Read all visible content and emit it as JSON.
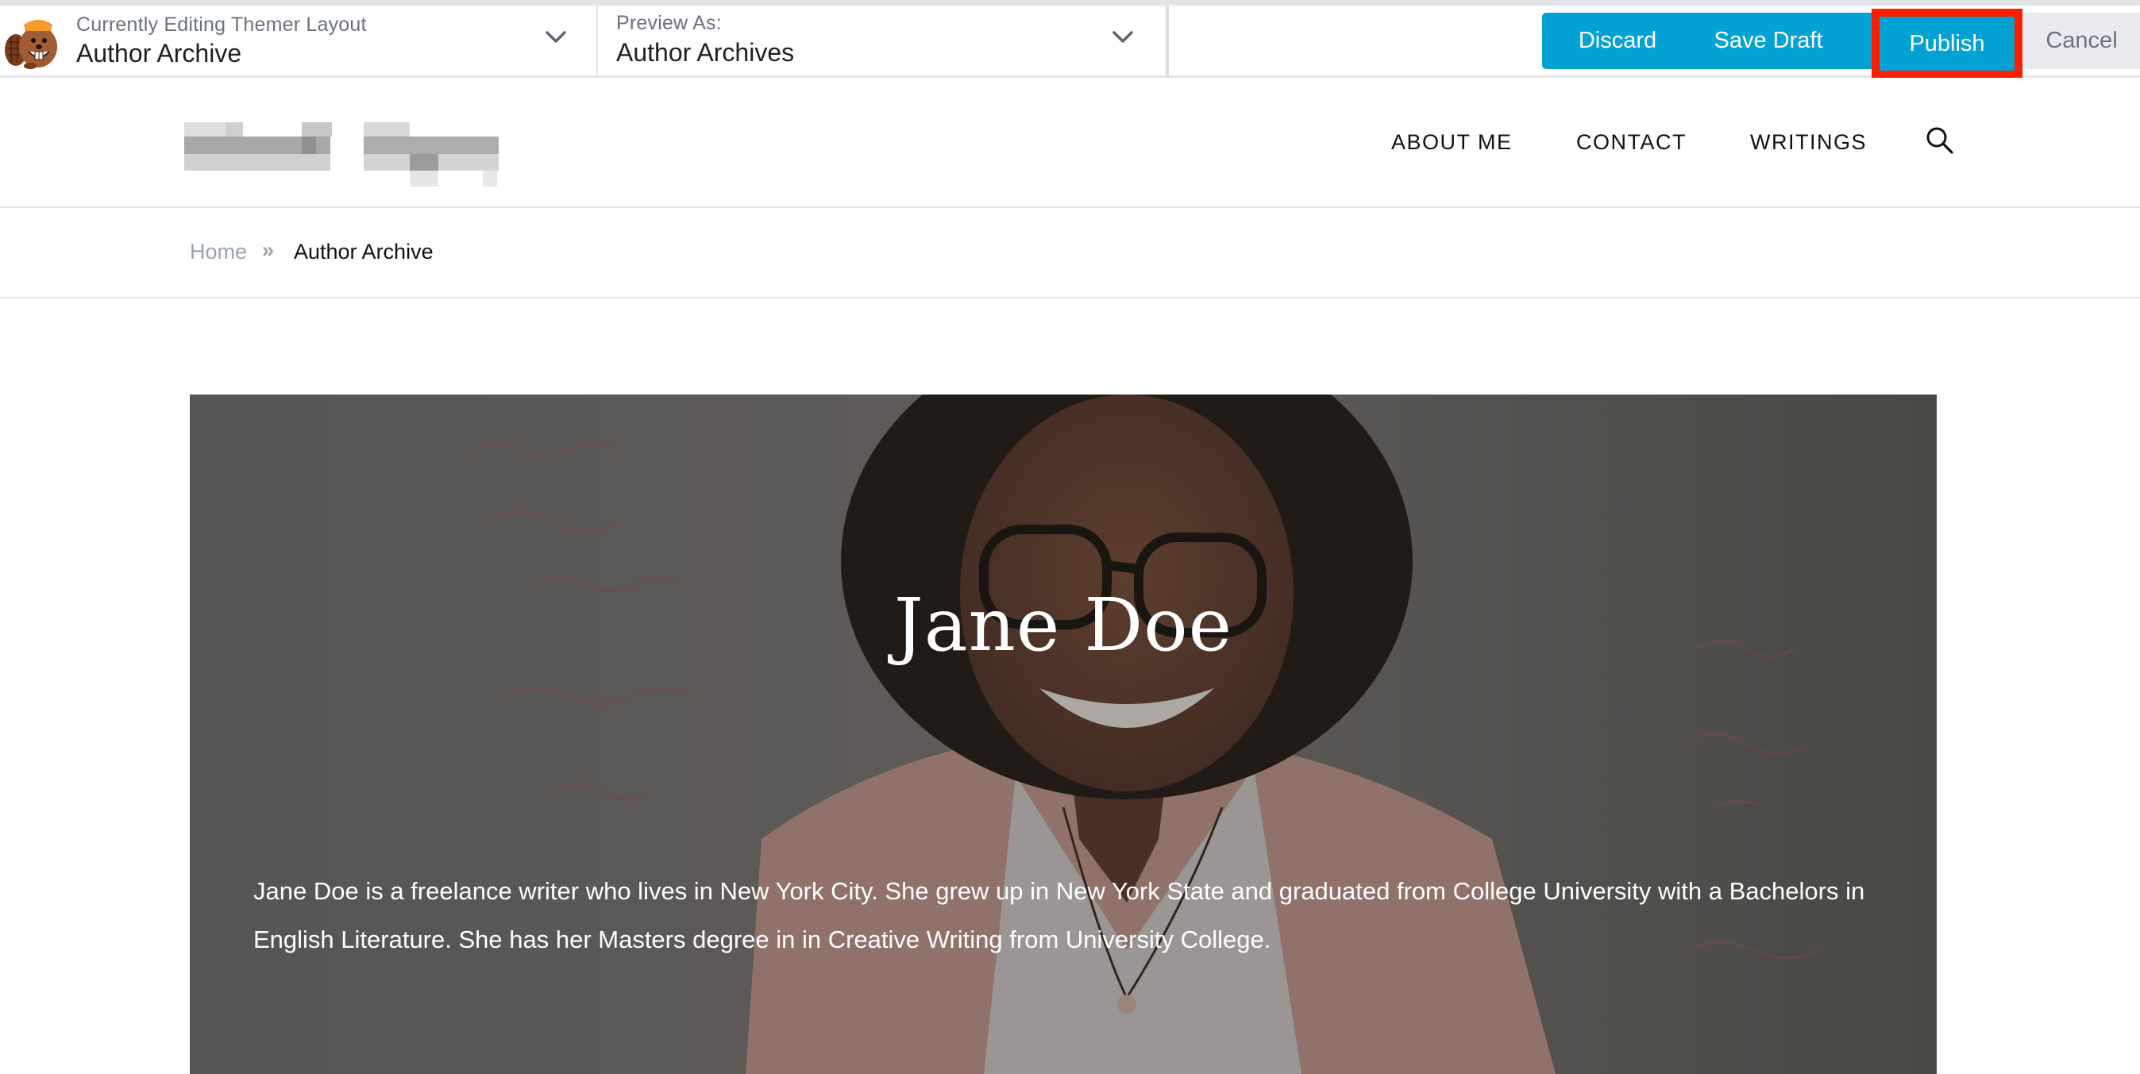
{
  "toolbar": {
    "layout_label": "Currently Editing Themer Layout",
    "layout_value": "Author Archive",
    "preview_label": "Preview As:",
    "preview_value": "Author Archives",
    "buttons": {
      "discard": "Discard",
      "save_draft": "Save Draft",
      "publish": "Publish",
      "cancel": "Cancel"
    },
    "accent_color": "#04a2d3",
    "highlight_color": "#ff1e00"
  },
  "header": {
    "logo": "site-logo (pixelated)",
    "nav": [
      "ABOUT ME",
      "CONTACT",
      "WRITINGS"
    ],
    "search_icon": "search-icon"
  },
  "breadcrumb": {
    "home": "Home",
    "separator": "»",
    "current": "Author Archive"
  },
  "hero": {
    "title": "Jane Doe",
    "bio": "Jane Doe is a freelance writer who lives in New York City. She grew up in New York State and graduated from College University with a Bachelors in English Literature. She has her Masters degree in in Creative Writing from University College."
  }
}
